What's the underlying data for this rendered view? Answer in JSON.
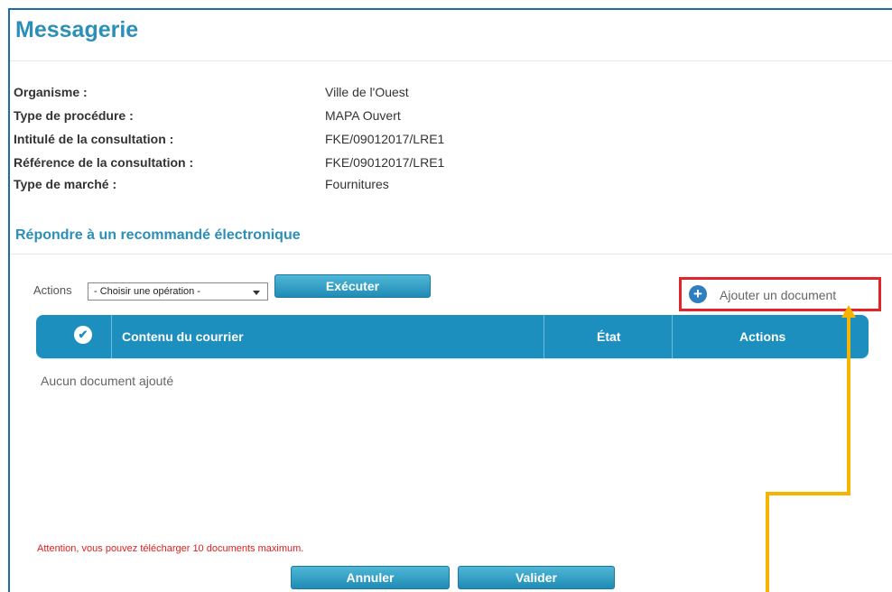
{
  "page": {
    "title": "Messagerie"
  },
  "info": {
    "rows": [
      {
        "label": "Organisme :",
        "value": "Ville de l'Ouest"
      },
      {
        "label": "Type de procédure :",
        "value": "MAPA Ouvert"
      },
      {
        "label": "Intitulé de la consultation :",
        "value": "FKE/09012017/LRE1"
      },
      {
        "label": "Référence de la consultation :",
        "value": "FKE/09012017/LRE1"
      },
      {
        "label": "Type de marché :",
        "value": "Fournitures"
      }
    ]
  },
  "section": {
    "title": "Répondre à un recommandé électronique"
  },
  "toolbar": {
    "actions_label": "Actions",
    "select_value": "- Choisir une opération -",
    "execute_label": "Exécuter",
    "add_document_label": "Ajouter un document",
    "add_icon": "plus-circle-icon"
  },
  "table": {
    "columns": [
      "Contenu du courrier",
      "État",
      "Actions"
    ],
    "empty_message": "Aucun document ajouté"
  },
  "footer": {
    "warning": "Attention, vous pouvez télécharger 10 documents maximum.",
    "cancel_label": "Annuler",
    "validate_label": "Valider"
  },
  "colors": {
    "title": "#2b8fb8",
    "table_header": "#1d8fbf",
    "highlight_box": "#e3242b",
    "annotation_arrow": "#f5b400",
    "warning": "#e41b1b"
  }
}
